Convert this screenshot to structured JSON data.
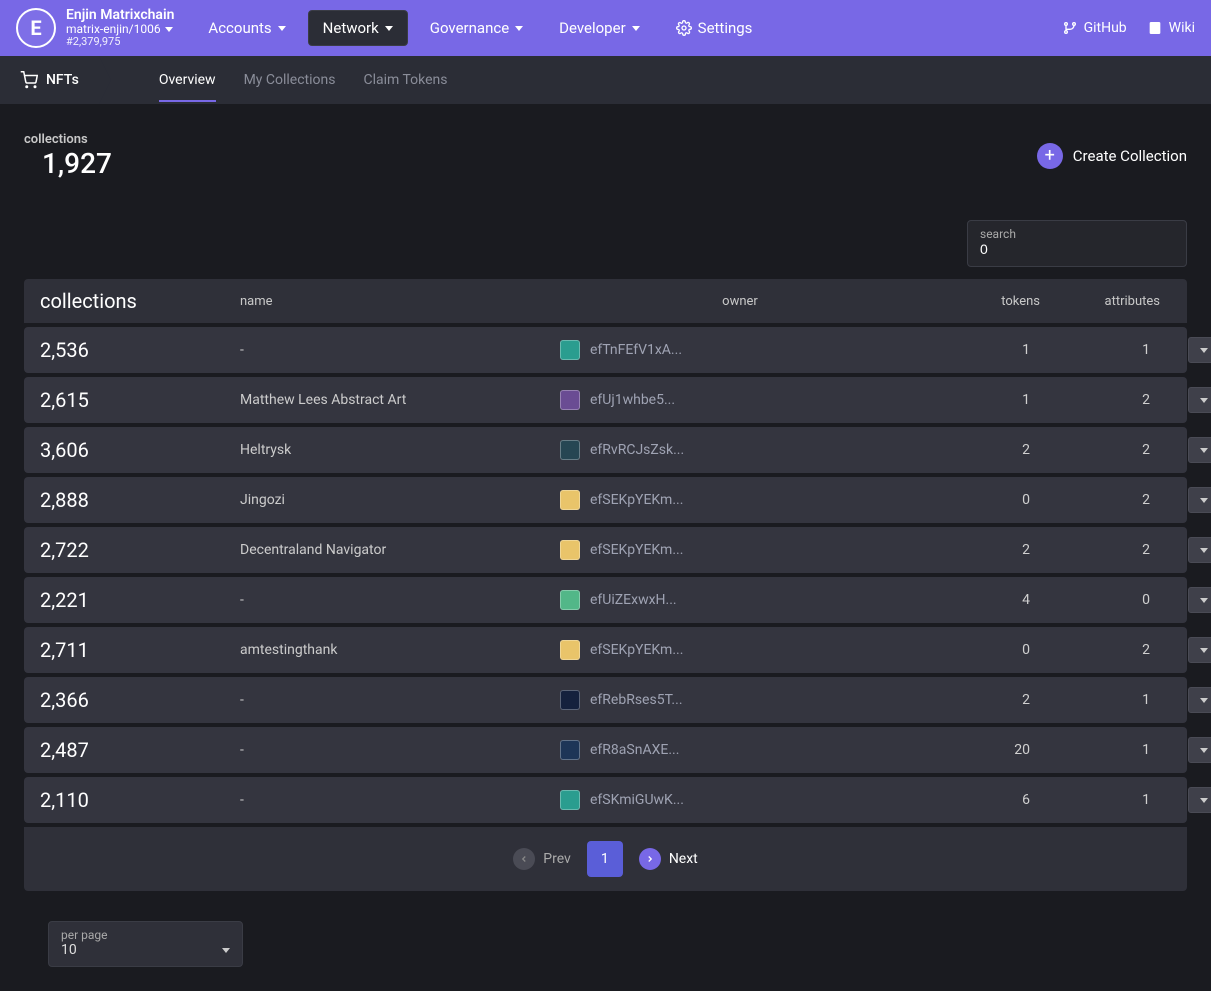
{
  "header": {
    "chain_title": "Enjin Matrixchain",
    "chain_id": "matrix-enjin/1006",
    "block": "#2,379,975",
    "nav": {
      "accounts": "Accounts",
      "network": "Network",
      "governance": "Governance",
      "developer": "Developer",
      "settings": "Settings"
    },
    "right": {
      "github": "GitHub",
      "wiki": "Wiki"
    }
  },
  "subnav": {
    "section": "NFTs",
    "tabs": {
      "overview": "Overview",
      "my_collections": "My Collections",
      "claim_tokens": "Claim Tokens"
    }
  },
  "stats": {
    "label": "collections",
    "value": "1,927"
  },
  "create_label": "Create Collection",
  "search": {
    "label": "search",
    "value": "0"
  },
  "table": {
    "headers": {
      "collections": "collections",
      "name": "name",
      "owner": "owner",
      "tokens": "tokens",
      "attributes": "attributes"
    },
    "rows": [
      {
        "id": "2,536",
        "name": "-",
        "owner": "efTnFEfV1xA...",
        "tokens": "1",
        "attributes": "1",
        "color": "#2a9d8f"
      },
      {
        "id": "2,615",
        "name": "Matthew Lees Abstract Art",
        "owner": "efUj1whbe5...",
        "tokens": "1",
        "attributes": "2",
        "color": "#6a4c93"
      },
      {
        "id": "3,606",
        "name": "Heltrysk",
        "owner": "efRvRCJsZsk...",
        "tokens": "2",
        "attributes": "2",
        "color": "#264653"
      },
      {
        "id": "2,888",
        "name": "Jingozi",
        "owner": "efSEKpYEKm...",
        "tokens": "0",
        "attributes": "2",
        "color": "#e9c46a"
      },
      {
        "id": "2,722",
        "name": "Decentraland Navigator",
        "owner": "efSEKpYEKm...",
        "tokens": "2",
        "attributes": "2",
        "color": "#e9c46a"
      },
      {
        "id": "2,221",
        "name": "-",
        "owner": "efUiZExwxH...",
        "tokens": "4",
        "attributes": "0",
        "color": "#52b788"
      },
      {
        "id": "2,711",
        "name": "amtestingthank",
        "owner": "efSEKpYEKm...",
        "tokens": "0",
        "attributes": "2",
        "color": "#e9c46a"
      },
      {
        "id": "2,366",
        "name": "-",
        "owner": "efRebRses5T...",
        "tokens": "2",
        "attributes": "1",
        "color": "#14213d"
      },
      {
        "id": "2,487",
        "name": "-",
        "owner": "efR8aSnAXE...",
        "tokens": "20",
        "attributes": "1",
        "color": "#1d3557"
      },
      {
        "id": "2,110",
        "name": "-",
        "owner": "efSKmiGUwK...",
        "tokens": "6",
        "attributes": "1",
        "color": "#2a9d8f"
      }
    ]
  },
  "pagination": {
    "prev": "Prev",
    "page": "1",
    "next": "Next"
  },
  "perpage": {
    "label": "per page",
    "value": "10"
  }
}
